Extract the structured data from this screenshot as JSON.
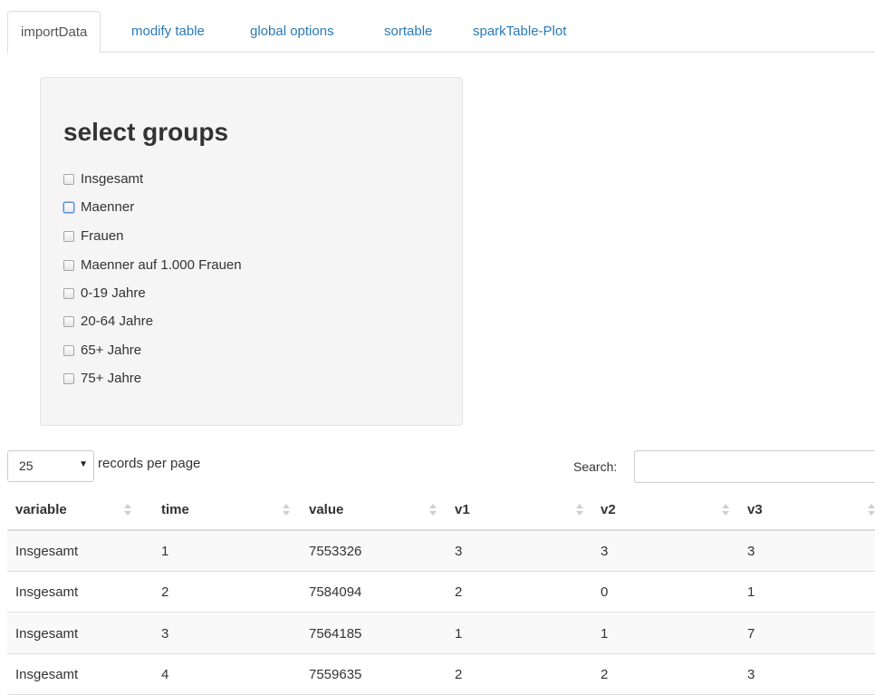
{
  "tabs": [
    {
      "label": "importData",
      "active": true
    },
    {
      "label": "modify table",
      "active": false
    },
    {
      "label": "global options",
      "active": false
    },
    {
      "label": "sortable",
      "active": false
    },
    {
      "label": "sparkTable-Plot",
      "active": false
    }
  ],
  "panel": {
    "title": "select groups",
    "groups": [
      {
        "label": "Insgesamt",
        "checked": false
      },
      {
        "label": "Maenner",
        "checked": false,
        "focused": true
      },
      {
        "label": "Frauen",
        "checked": false
      },
      {
        "label": "Maenner auf 1.000 Frauen",
        "checked": false
      },
      {
        "label": "0-19 Jahre",
        "checked": false
      },
      {
        "label": "20-64 Jahre",
        "checked": false
      },
      {
        "label": "65+ Jahre",
        "checked": false
      },
      {
        "label": "75+ Jahre",
        "checked": false
      }
    ]
  },
  "table_controls": {
    "page_length": "25",
    "page_length_label": "records per page",
    "search_label": "Search:",
    "search_value": ""
  },
  "table": {
    "columns": [
      "variable",
      "time",
      "value",
      "v1",
      "v2",
      "v3"
    ],
    "rows": [
      [
        "Insgesamt",
        "1",
        "7553326",
        "3",
        "3",
        "3"
      ],
      [
        "Insgesamt",
        "2",
        "7584094",
        "2",
        "0",
        "1"
      ],
      [
        "Insgesamt",
        "3",
        "7564185",
        "1",
        "1",
        "7"
      ],
      [
        "Insgesamt",
        "4",
        "7559635",
        "2",
        "2",
        "3"
      ]
    ]
  }
}
